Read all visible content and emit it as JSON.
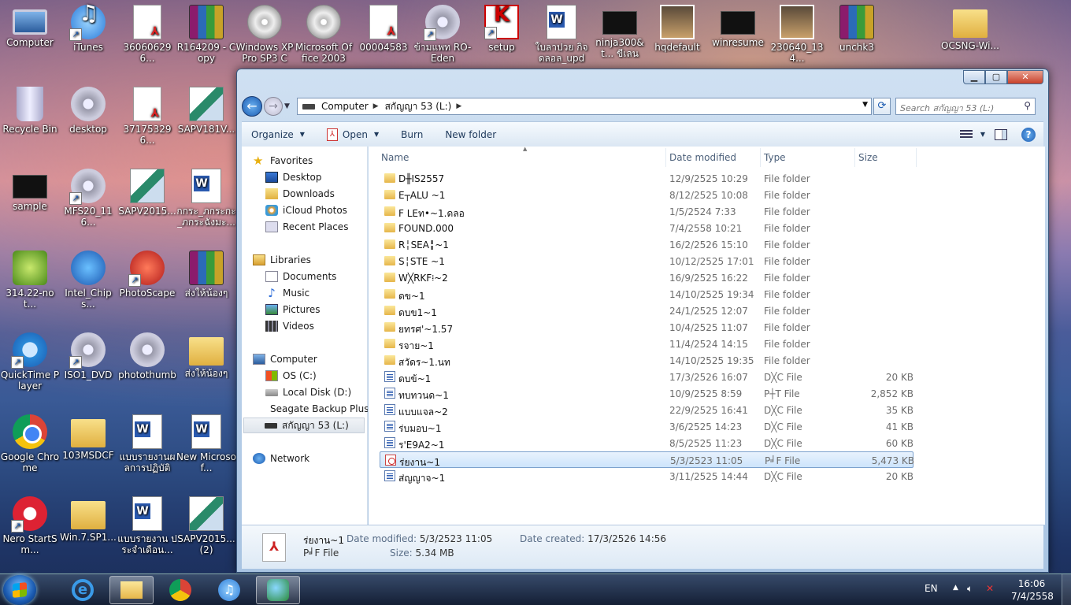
{
  "desktop_icons": [
    {
      "label": "Computer",
      "icon": "computer-icon"
    },
    {
      "label": "iTunes",
      "icon": "itunes-icon"
    },
    {
      "label": "360606296...",
      "icon": "pdf-icon"
    },
    {
      "label": "R164209 - Copy",
      "icon": "winrar-icon"
    },
    {
      "label": "Windows XP Pro SP3 CD...",
      "icon": "cd-icon"
    },
    {
      "label": "Microsoft Office 2003",
      "icon": "cd-icon"
    },
    {
      "label": "00004583",
      "icon": "pdf-icon"
    },
    {
      "label": "ข้ามแพท RO-Eden",
      "icon": "program-icon"
    },
    {
      "label": "setup",
      "icon": "kaspersky-icon"
    },
    {
      "label": "ใบลาปวย กิจ ดลอล_upd",
      "icon": "word-icon"
    },
    {
      "label": "ninja300&t... ขีเลน",
      "icon": "video-icon"
    },
    {
      "label": "hqdefault",
      "icon": "image-icon"
    },
    {
      "label": "winresume",
      "icon": "console-icon"
    },
    {
      "label": "230640_134...",
      "icon": "photo-icon"
    },
    {
      "label": "unchk3",
      "icon": "winrar-icon"
    },
    {
      "label": "OCSNG-Wi...",
      "icon": "folder-icon"
    },
    {
      "label": "Recycle Bin",
      "icon": "recycle-bin-icon"
    },
    {
      "label": "desktop",
      "icon": "settings-icon"
    },
    {
      "label": "371753296...",
      "icon": "pdf-icon"
    },
    {
      "label": "SAPV181V...",
      "icon": "sap-icon"
    },
    {
      "label": "sample",
      "icon": "console-icon"
    },
    {
      "label": "MFS20_116...",
      "icon": "program-icon"
    },
    {
      "label": "SAPV2015...",
      "icon": "sap-icon"
    },
    {
      "label": "กกระ_ภกระกะ_ภกระฉังมะ...",
      "icon": "word-icon"
    },
    {
      "label": "314.22-not...",
      "icon": "nvidia-icon"
    },
    {
      "label": "Intel_Chips...",
      "icon": "intel-icon"
    },
    {
      "label": "PhotoScape",
      "icon": "photoscape-icon"
    },
    {
      "label": "ส่งให้น้องๆ",
      "icon": "winrar-icon"
    },
    {
      "label": "QuickTime Player",
      "icon": "quicktime-icon"
    },
    {
      "label": "ISO1_DVD",
      "icon": "program-icon"
    },
    {
      "label": "photothumb",
      "icon": "settings-icon"
    },
    {
      "label": "ส่งให้น้องๆ",
      "icon": "folder-icon"
    },
    {
      "label": "Google Chrome",
      "icon": "chrome-icon"
    },
    {
      "label": "103MSDCF",
      "icon": "folder-icon"
    },
    {
      "label": "แบบรายงานผลการปฏิบัติง...",
      "icon": "word-icon"
    },
    {
      "label": "New Microsof...",
      "icon": "word-icon"
    },
    {
      "label": "Nero StartSm...",
      "icon": "nero-icon"
    },
    {
      "label": "Win.7.SP1...",
      "icon": "folder-icon"
    },
    {
      "label": "แบบรายงาน ประจำเดือน...",
      "icon": "word-icon"
    },
    {
      "label": "SAPV2015... (2)",
      "icon": "sap-icon"
    }
  ],
  "window": {
    "controls": {
      "minimize": "▁",
      "maximize": "▢",
      "close": "✕"
    },
    "address": {
      "root": "Computer",
      "drive": "สกัญญา 53 (L:)"
    },
    "search_placeholder": "Search สกัญญา 53 (L:)",
    "toolbar": {
      "organize": "Organize",
      "open": "Open",
      "burn": "Burn",
      "new_folder": "New folder"
    },
    "nav": {
      "favorites": "Favorites",
      "desktop": "Desktop",
      "downloads": "Downloads",
      "icloud": "iCloud Photos",
      "recent": "Recent Places",
      "libraries": "Libraries",
      "documents": "Documents",
      "music": "Music",
      "pictures": "Pictures",
      "videos": "Videos",
      "computer": "Computer",
      "os": "OS (C:)",
      "local_d": "Local Disk (D:)",
      "seagate": "Seagate Backup Plus",
      "drive_l": "สกัญญา 53 (L:)",
      "network": "Network"
    },
    "columns": {
      "name": "Name",
      "date": "Date modified",
      "type": "Type",
      "size": "Size"
    },
    "files": [
      {
        "name": "D╫IS2557",
        "date": "12/9/2525 10:29",
        "type": "File folder",
        "size": "",
        "kind": "folder"
      },
      {
        "name": "E┬ALU    ~1",
        "date": "8/12/2525 10:08",
        "type": "File folder",
        "size": "",
        "kind": "folder"
      },
      {
        "name": "F LEท•~1.ดลอ",
        "date": "1/5/2524 7:33",
        "type": "File folder",
        "size": "",
        "kind": "folder"
      },
      {
        "name": "FOUND.000",
        "date": "7/4/2558 10:21",
        "type": "File folder",
        "size": "",
        "kind": "folder"
      },
      {
        "name": "R╎SEA╏~1",
        "date": "16/2/2526 15:10",
        "type": "File folder",
        "size": "",
        "kind": "folder"
      },
      {
        "name": "S╎STE ~1",
        "date": "10/12/2525 17:01",
        "type": "File folder",
        "size": "",
        "kind": "folder"
      },
      {
        "name": "W╳RKF፧~2",
        "date": "16/9/2525 16:22",
        "type": "File folder",
        "size": "",
        "kind": "folder"
      },
      {
        "name": "ดข~1",
        "date": "14/10/2525 19:34",
        "type": "File folder",
        "size": "",
        "kind": "folder"
      },
      {
        "name": "ดบข1~1",
        "date": "24/1/2525 12:07",
        "type": "File folder",
        "size": "",
        "kind": "folder"
      },
      {
        "name": "ยทรศ'~1.57",
        "date": "10/4/2525 11:07",
        "type": "File folder",
        "size": "",
        "kind": "folder"
      },
      {
        "name": "รจาย~1",
        "date": "11/4/2524 14:15",
        "type": "File folder",
        "size": "",
        "kind": "folder"
      },
      {
        "name": "สวัดร~1.นท",
        "date": "14/10/2525 19:35",
        "type": "File folder",
        "size": "",
        "kind": "folder"
      },
      {
        "name": "ดบข้~1",
        "date": "17/3/2526 16:07",
        "type": "D╳C File",
        "size": "20 KB",
        "kind": "doc"
      },
      {
        "name": "ทบทวนด~1",
        "date": "10/9/2525 8:59",
        "type": "P┼T File",
        "size": "2,852 KB",
        "kind": "doc"
      },
      {
        "name": "แบบแจล~2",
        "date": "22/9/2525 16:41",
        "type": "D╳C File",
        "size": "35 KB",
        "kind": "doc"
      },
      {
        "name": "ร่บมอบ~1",
        "date": "3/6/2525 14:23",
        "type": "D╳C File",
        "size": "41 KB",
        "kind": "doc"
      },
      {
        "name": "ร'E9A2~1",
        "date": "8/5/2525 11:23",
        "type": "D╳C File",
        "size": "60 KB",
        "kind": "doc"
      },
      {
        "name": "ร่ยงาน~1",
        "date": "5/3/2523 11:05",
        "type": "P╛F File",
        "size": "5,473 KB",
        "kind": "pdf"
      },
      {
        "name": "ส่ญญาจ~1",
        "date": "3/11/2525 14:44",
        "type": "D╳C File",
        "size": "20 KB",
        "kind": "doc"
      }
    ],
    "details": {
      "name": "ร่ยงาน~1",
      "type": "P╛F File",
      "modified_label": "Date modified:",
      "modified": "5/3/2523 11:05",
      "size_label": "Size:",
      "size": "5.34 MB",
      "created_label": "Date created:",
      "created": "17/3/2526 14:56"
    }
  },
  "taskbar": {
    "lang": "EN",
    "time": "16:06",
    "date": "7/4/2558"
  }
}
